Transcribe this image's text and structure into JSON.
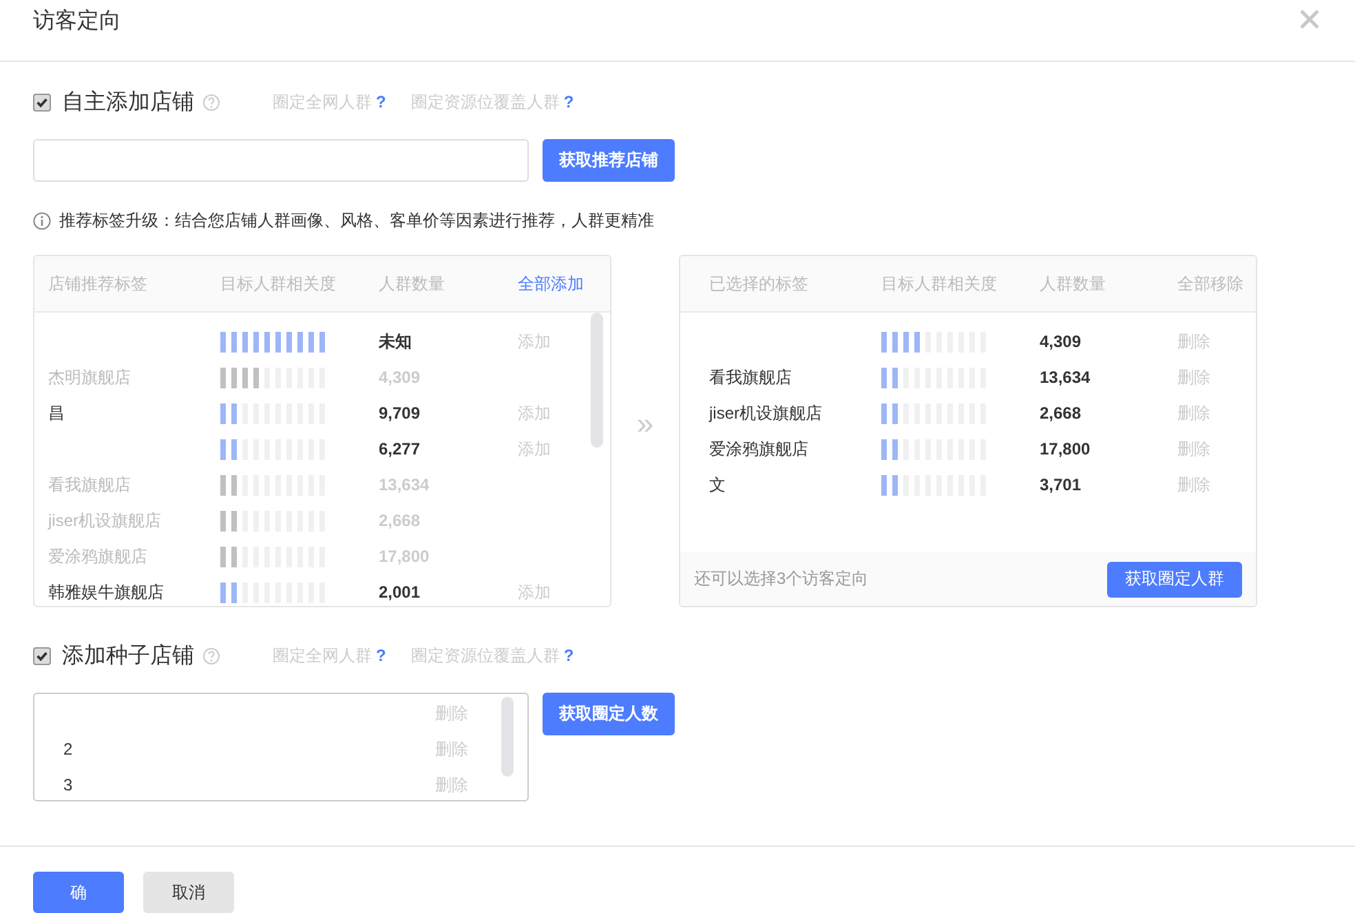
{
  "dialog": {
    "title": "访客定向"
  },
  "self_add": {
    "checked": true,
    "label": "自主添加店铺",
    "links": [
      {
        "label": "圈定全网人群",
        "mark": "?"
      },
      {
        "label": "圈定资源位覆盖人群",
        "mark": "?"
      }
    ],
    "button": "获取推荐店铺",
    "info": "推荐标签升级：结合您店铺人群画像、风格、客单价等因素进行推荐，人群更精准"
  },
  "recommend_table": {
    "columns": [
      "店铺推荐标签",
      "目标人群相关度",
      "人群数量"
    ],
    "action": "全部添加",
    "rows": [
      {
        "added": false,
        "level": 1.0,
        "count": "未知",
        "action": "添加"
      },
      {
        "added": true,
        "name": "杰明旗舰店",
        "level": 0.4,
        "count": "4,309"
      },
      {
        "added": false,
        "name": "昌",
        "level": 0.2,
        "count": "9,709",
        "action": "添加"
      },
      {
        "added": false,
        "level": 0.2,
        "count": "6,277",
        "action": "添加"
      },
      {
        "added": true,
        "name": "看我旗舰店",
        "level": 0.2,
        "count": "13,634"
      },
      {
        "added": true,
        "name": "jiser机设旗舰店",
        "level": 0.2,
        "count": "2,668"
      },
      {
        "added": true,
        "name": "爱涂鸦旗舰店",
        "level": 0.2,
        "count": "17,800"
      },
      {
        "added": false,
        "name": "韩雅娱牛旗舰店",
        "level": 0.2,
        "count": "2,001",
        "action": "添加"
      }
    ]
  },
  "arrow": "»",
  "selected_table": {
    "columns": [
      "已选择的标签",
      "目标人群相关度",
      "人群数量"
    ],
    "action": "全部移除",
    "rows": [
      {
        "level": 0.4,
        "count": "4,309",
        "action": "删除"
      },
      {
        "name": "看我旗舰店",
        "level": 0.2,
        "count": "13,634",
        "action": "删除"
      },
      {
        "name": "jiser机设旗舰店",
        "level": 0.2,
        "count": "2,668",
        "action": "删除"
      },
      {
        "name": "爱涂鸦旗舰店",
        "level": 0.2,
        "count": "17,800",
        "action": "删除"
      },
      {
        "name": "文",
        "level": 0.2,
        "count": "3,701",
        "action": "删除"
      }
    ],
    "note": "还可以选择3个访客定向",
    "button": "获取圈定人群"
  },
  "seed_add": {
    "checked": true,
    "label": "添加种子店铺",
    "links": [
      {
        "label": "圈定全网人群",
        "mark": "?"
      },
      {
        "label": "圈定资源位覆盖人群",
        "mark": "?"
      }
    ],
    "button": "获取圈定人数",
    "rows": [
      {
        "action": "删除"
      },
      {
        "index": "2",
        "action": "删除"
      },
      {
        "index": "3",
        "action": "删除"
      }
    ]
  },
  "footer": {
    "buttons": [
      {
        "label": "确",
        "kind": "primary"
      },
      {
        "label": "取消",
        "kind": "secondary"
      }
    ]
  }
}
